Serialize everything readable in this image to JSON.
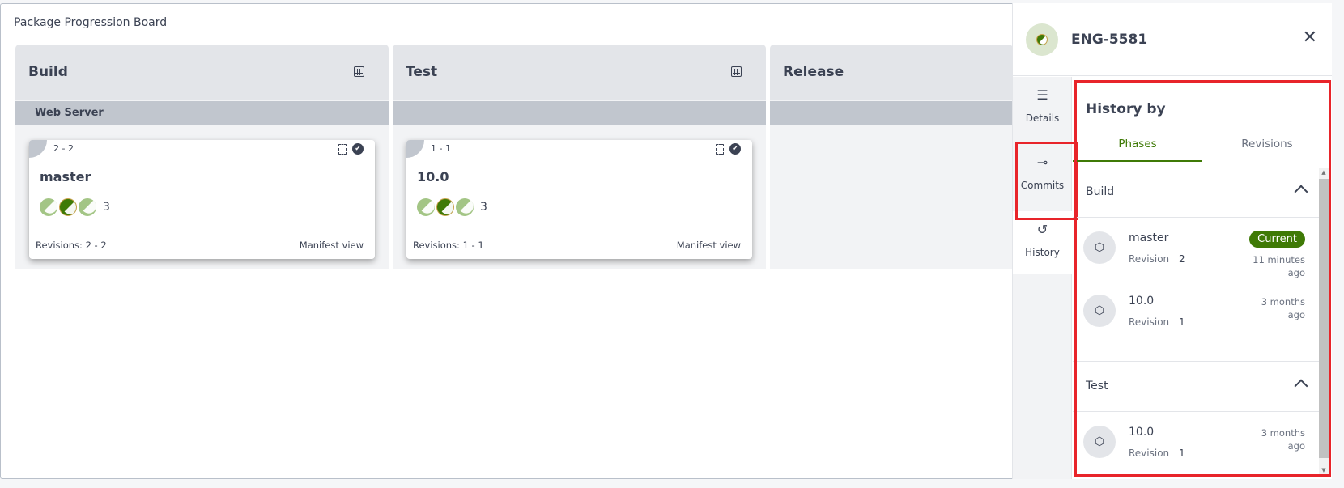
{
  "board": {
    "title": "Package Progression Board",
    "columns": [
      {
        "title": "Build",
        "group": "Web Server",
        "card": {
          "range": "2 - 2",
          "name": "master",
          "avatar_count": "3",
          "revisions": "Revisions: 2 - 2",
          "manifest_link": "Manifest view"
        }
      },
      {
        "title": "Test",
        "group": "",
        "card": {
          "range": "1 - 1",
          "name": "10.0",
          "avatar_count": "3",
          "revisions": "Revisions: 1 - 1",
          "manifest_link": "Manifest view"
        }
      },
      {
        "title": "Release",
        "group": ""
      }
    ]
  },
  "panel": {
    "title": "ENG-5581",
    "close_icon": "close-icon",
    "nav": [
      {
        "label": "Details",
        "icon": "list-icon"
      },
      {
        "label": "Commits",
        "icon": "commit-icon"
      },
      {
        "label": "History",
        "icon": "history-icon",
        "active": true
      }
    ],
    "history_title": "History by",
    "tabs": [
      {
        "label": "Phases",
        "active": true
      },
      {
        "label": "Revisions",
        "active": false
      }
    ],
    "phases": [
      {
        "name": "Build",
        "items": [
          {
            "name": "master",
            "revision_label": "Revision",
            "revision": "2",
            "badge": "Current",
            "time_1": "11 minutes",
            "time_2": "ago"
          },
          {
            "name": "10.0",
            "revision_label": "Revision",
            "revision": "1",
            "time_1": "3 months",
            "time_2": "ago"
          }
        ]
      },
      {
        "name": "Test",
        "items": [
          {
            "name": "10.0",
            "revision_label": "Revision",
            "revision": "1",
            "time_1": "3 months",
            "time_2": "ago"
          }
        ]
      }
    ]
  },
  "colors": {
    "accent_green": "#3f7a06",
    "highlight_red": "#e8242a",
    "text": "#3b4253"
  }
}
